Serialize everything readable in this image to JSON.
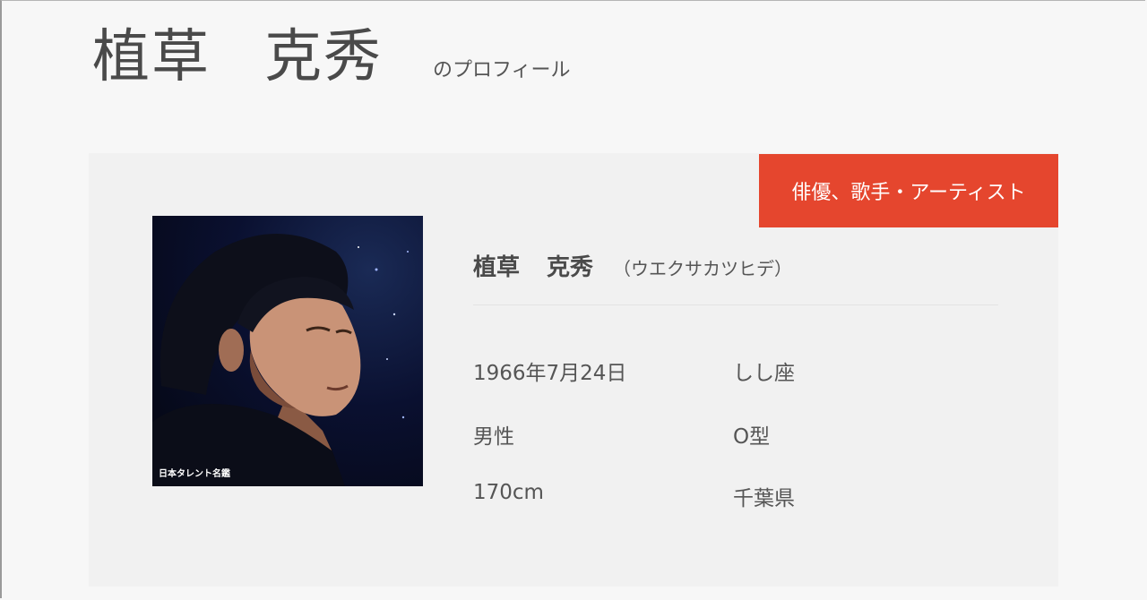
{
  "header": {
    "name": "植草　克秀",
    "name_family": "植草",
    "name_given": "克秀",
    "suffix": "のプロフィール"
  },
  "profile": {
    "category": "俳優、歌手・アーティスト",
    "photo_caption": "日本タレント名鑑",
    "name_family": "植草",
    "name_given": "克秀",
    "kana": "（ウエクサカツヒデ）",
    "birthday": "1966年7月24日",
    "zodiac": "しし座",
    "gender": "男性",
    "blood_type": "O型",
    "height": "170cm",
    "birthplace": "千葉県"
  },
  "colors": {
    "accent": "#e5462e",
    "card_background": "#f1f1f1",
    "page_background": "#f7f7f7"
  }
}
